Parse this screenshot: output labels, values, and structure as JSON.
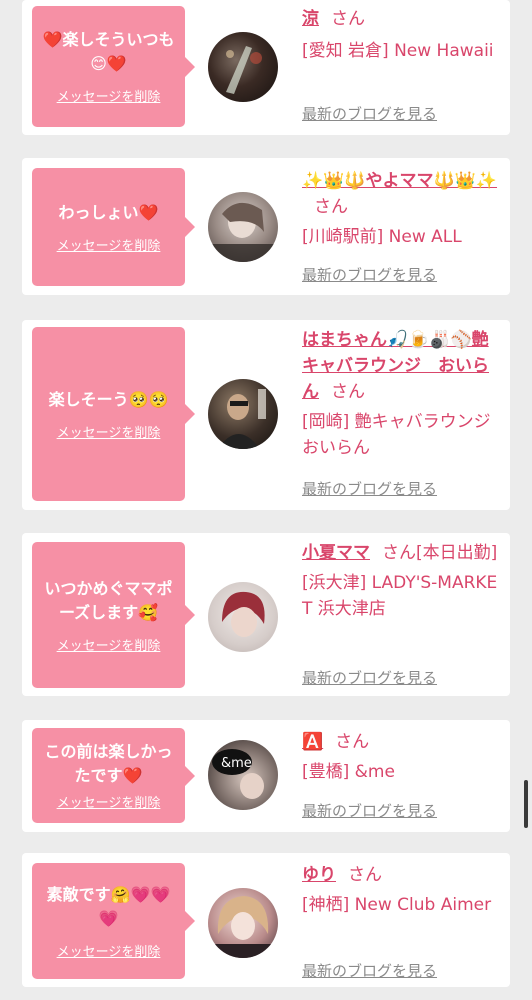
{
  "colors": {
    "accent": "#d9466b",
    "bubble": "#f690a5",
    "background": "#ececec"
  },
  "delete_label": "メッセージを削除",
  "blog_label": "最新のブログを見る",
  "san_label": "さん",
  "messages": [
    {
      "message": "❤️楽しそういつも😊❤️",
      "name": "涼",
      "status": "",
      "shop": "[愛知 岩倉] New Hawaii"
    },
    {
      "message": "わっしょい❤️",
      "name": "✨👑🔱やよママ🔱👑✨",
      "status": "",
      "shop": "[川崎駅前] New ALL"
    },
    {
      "message": "楽しそーう🥺🥺",
      "name": "はまちゃん🎣🍺🎳⚾艶キャバラウンジ　おいらん",
      "status": "",
      "shop": "[岡崎] 艶キャバラウンジ おいらん"
    },
    {
      "message": "いつかめぐママポーズします🥰",
      "name": "小夏ママ",
      "status": "[本日出勤]",
      "shop": "[浜大津] LADY'S-MARKET 浜大津店"
    },
    {
      "message": "この前は楽しかったです❤️",
      "name": "🅰️",
      "status": "",
      "shop": "[豊橋] &me"
    },
    {
      "message": "素敵です🤗💗💗💗",
      "name": "ゆり",
      "status": "",
      "shop": "[神栖] New Club Aimer"
    }
  ]
}
